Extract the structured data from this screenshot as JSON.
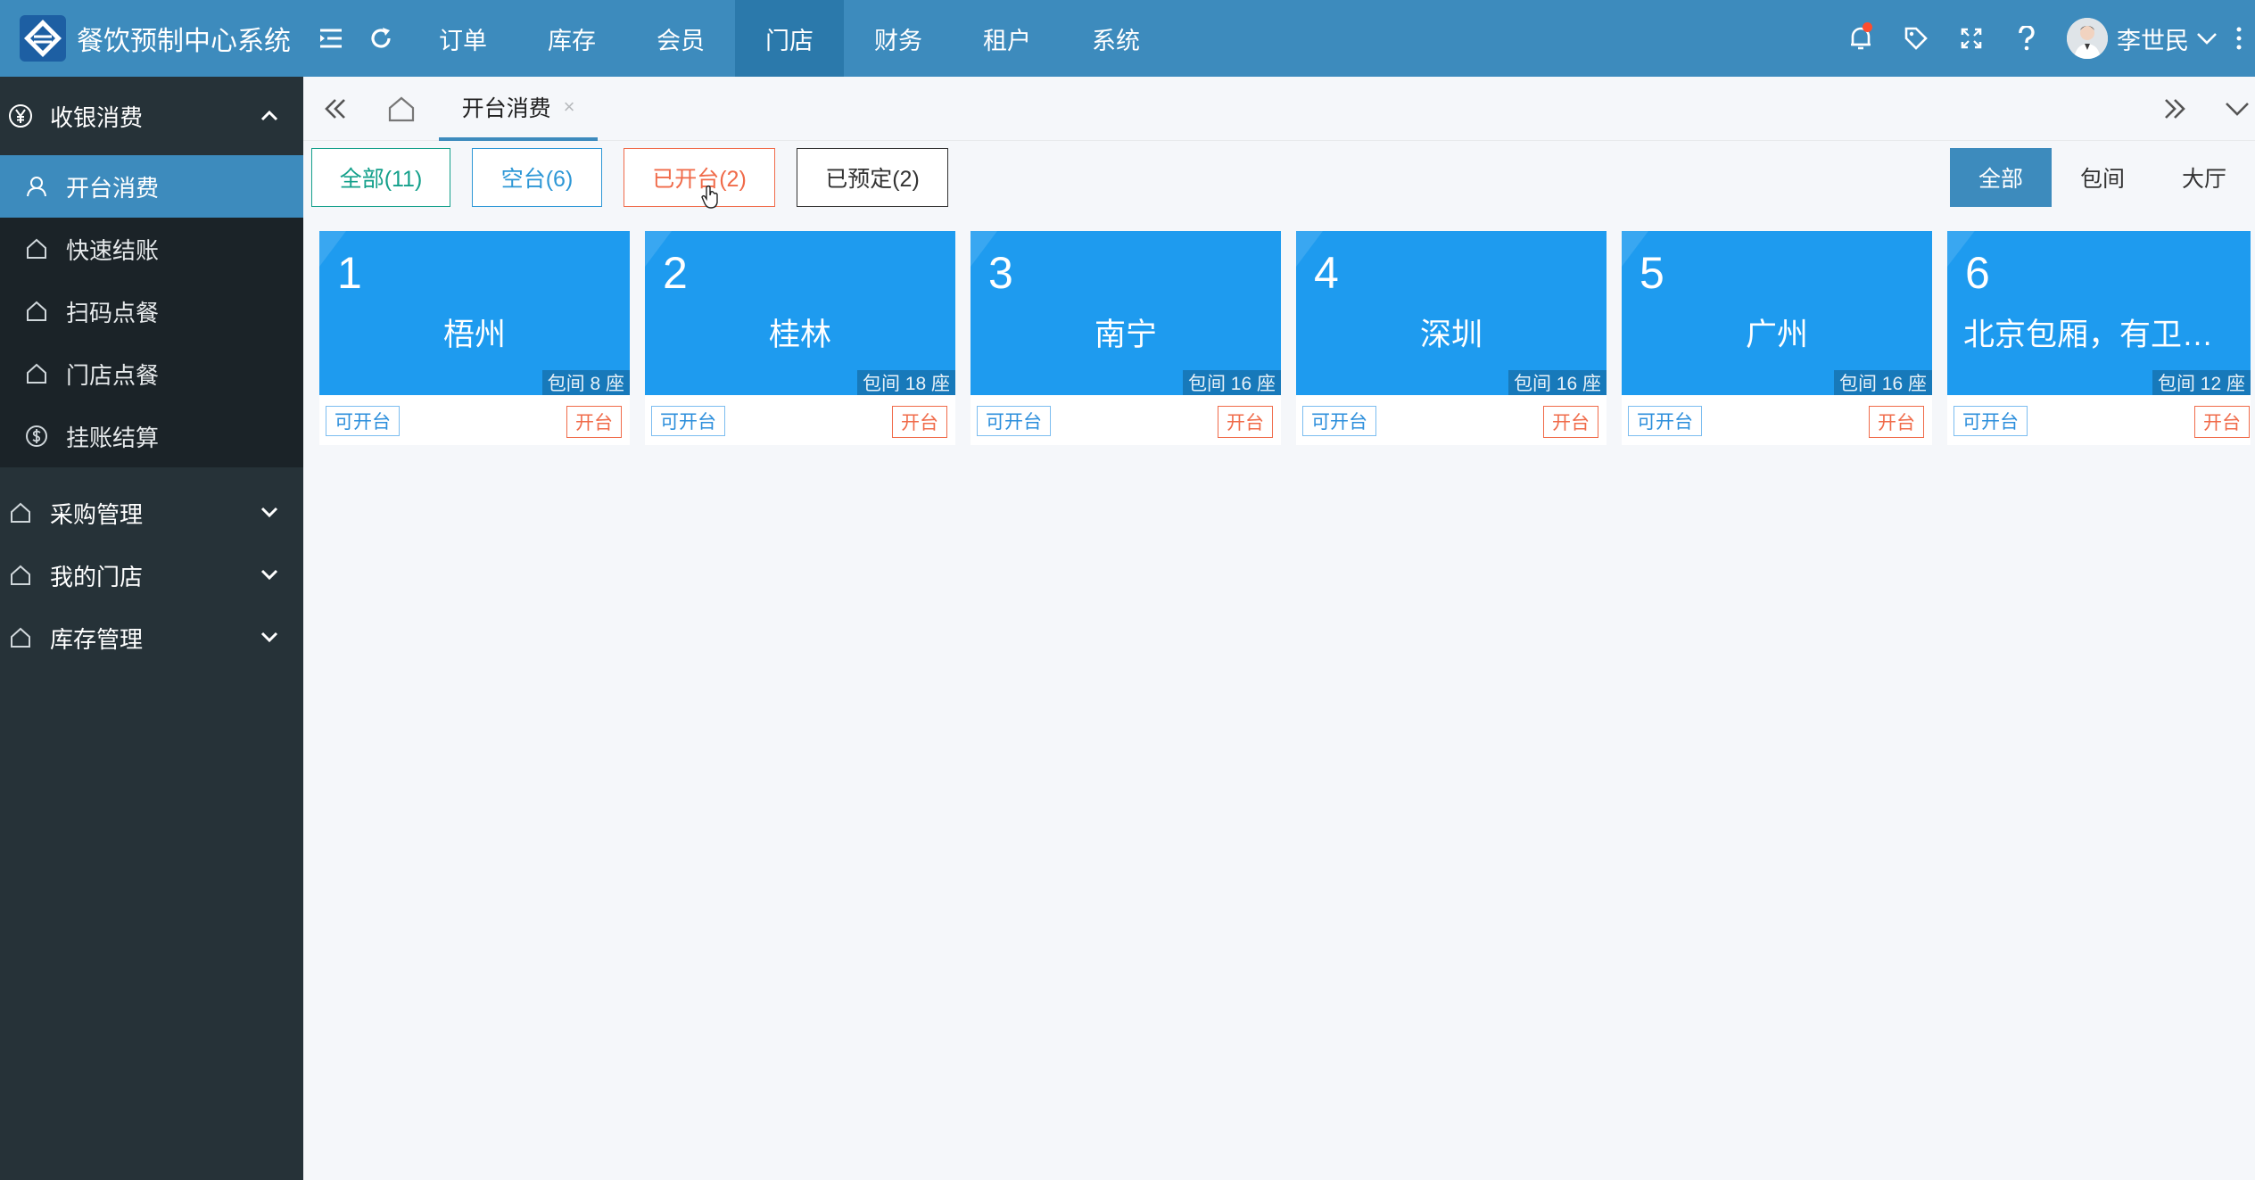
{
  "app": {
    "title": "餐饮预制中心系统"
  },
  "topnav": {
    "items": [
      {
        "label": "订单"
      },
      {
        "label": "库存"
      },
      {
        "label": "会员"
      },
      {
        "label": "门店",
        "active": true
      },
      {
        "label": "财务"
      },
      {
        "label": "租户"
      },
      {
        "label": "系统"
      }
    ]
  },
  "user": {
    "name": "李世民"
  },
  "sidebar": {
    "open_group": {
      "label": "收银消费",
      "icon": "yen-icon",
      "items": [
        {
          "label": "开台消费",
          "icon": "user-icon",
          "active": true
        },
        {
          "label": "快速结账",
          "icon": "home-icon"
        },
        {
          "label": "扫码点餐",
          "icon": "home-icon"
        },
        {
          "label": "门店点餐",
          "icon": "home-icon"
        },
        {
          "label": "挂账结算",
          "icon": "dollar-icon"
        }
      ]
    },
    "groups": [
      {
        "label": "采购管理"
      },
      {
        "label": "我的门店"
      },
      {
        "label": "库存管理"
      }
    ]
  },
  "tabs": {
    "current": {
      "label": "开台消费",
      "close": "×"
    }
  },
  "filters": {
    "all": "全部(11)",
    "empty": "空台(6)",
    "opened": "已开台(2)",
    "reserved": "已预定(2)"
  },
  "type_filter": {
    "all": "全部",
    "private": "包间",
    "hall": "大厅"
  },
  "tables": [
    {
      "num": "1",
      "name": "梧州",
      "seats": "包间 8 座",
      "status": "可开台",
      "action": "开台"
    },
    {
      "num": "2",
      "name": "桂林",
      "seats": "包间 18 座",
      "status": "可开台",
      "action": "开台"
    },
    {
      "num": "3",
      "name": "南宁",
      "seats": "包间 16 座",
      "status": "可开台",
      "action": "开台"
    },
    {
      "num": "4",
      "name": "深圳",
      "seats": "包间 16 座",
      "status": "可开台",
      "action": "开台"
    },
    {
      "num": "5",
      "name": "广州",
      "seats": "包间 16 座",
      "status": "可开台",
      "action": "开台"
    },
    {
      "num": "6",
      "name": "北京包厢，有卫…",
      "seats": "包间 12 座",
      "status": "可开台",
      "action": "开台"
    }
  ],
  "colors": {
    "header": "#3d8bbd",
    "sidebar": "#263238",
    "card": "#1e9bef",
    "accent_orange": "#f06b4a",
    "accent_teal": "#14a08b"
  }
}
